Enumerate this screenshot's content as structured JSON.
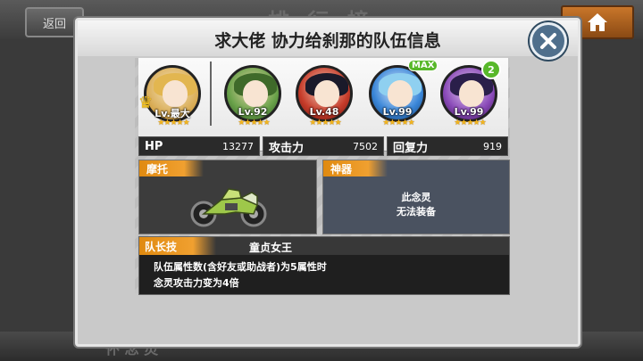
{
  "background": {
    "back_label": "返回",
    "screen_title": "排 行 榜",
    "home_icon": "home-icon",
    "bottom_text": "怀 念 灵"
  },
  "dialog": {
    "title": "求大佬 协力给刹那的队伍信息",
    "close_icon": "close-icon"
  },
  "team": [
    {
      "level": "Lv.最大",
      "stars": "★★★★★",
      "attribute": "light",
      "leader": true
    },
    {
      "level": "Lv.92",
      "stars": "★★★★★",
      "attribute": "wood"
    },
    {
      "level": "Lv.48",
      "stars": "★★★★★",
      "attribute": "fire"
    },
    {
      "level": "Lv.99",
      "stars": "★★★★★",
      "attribute": "water",
      "badge": "MAX"
    },
    {
      "level": "Lv.99",
      "stars": "★★★★★",
      "attribute": "dark",
      "badge": "2"
    }
  ],
  "stats": [
    {
      "label": "HP",
      "value": "13277"
    },
    {
      "label": "攻击力",
      "value": "7502"
    },
    {
      "label": "回复力",
      "value": "919"
    }
  ],
  "motor": {
    "label": "摩托"
  },
  "artifact": {
    "label": "神器",
    "line1": "此念灵",
    "line2": "无法装备"
  },
  "leader_skill": {
    "tag": "队长技",
    "name": "童贞女王",
    "desc1": "队伍属性数(含好友或助战者)为5属性时",
    "desc2": "念灵攻击力变为4倍"
  },
  "colors": {
    "accent": "#f0a030",
    "panel_dark": "#2a2a2a",
    "close": "#4f6f8c"
  }
}
